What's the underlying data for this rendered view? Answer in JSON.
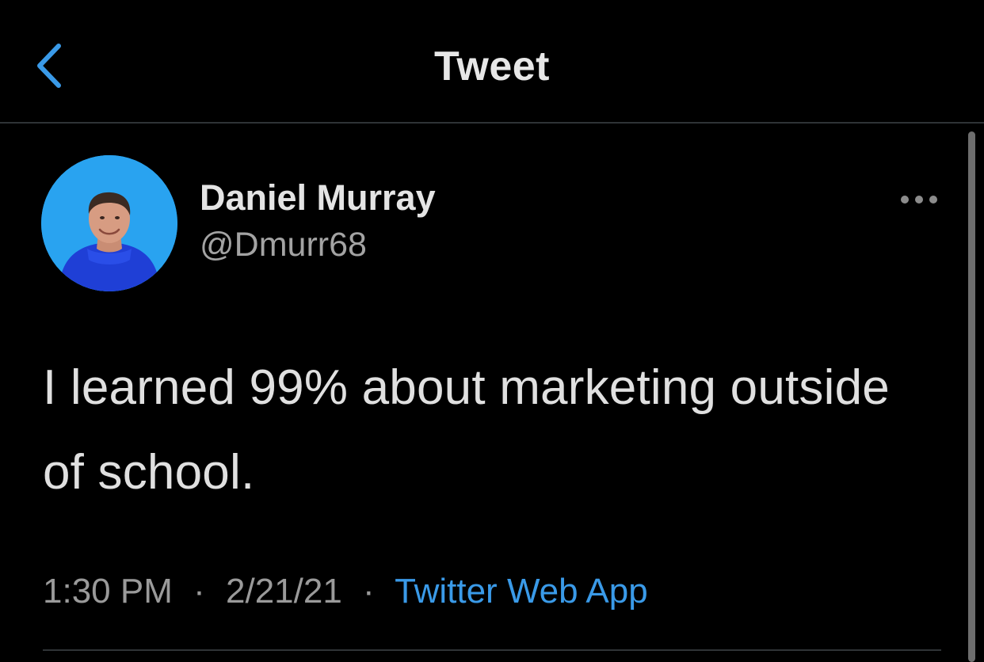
{
  "header": {
    "title": "Tweet",
    "back_icon": "chevron-left-icon"
  },
  "tweet": {
    "author_name": "Daniel Murray",
    "author_handle": "@Dmurr68",
    "more_icon": "more-horizontal-icon",
    "text": "I learned 99% about marketing outside of school.",
    "time": "1:30 PM",
    "date": "2/21/21",
    "separator": "·",
    "source": "Twitter Web App"
  },
  "colors": {
    "background": "#000000",
    "accent": "#3a9ae8",
    "avatar_bg": "#29a3f0",
    "divider": "#2f3336",
    "secondary_text": "#9a9a9a"
  }
}
